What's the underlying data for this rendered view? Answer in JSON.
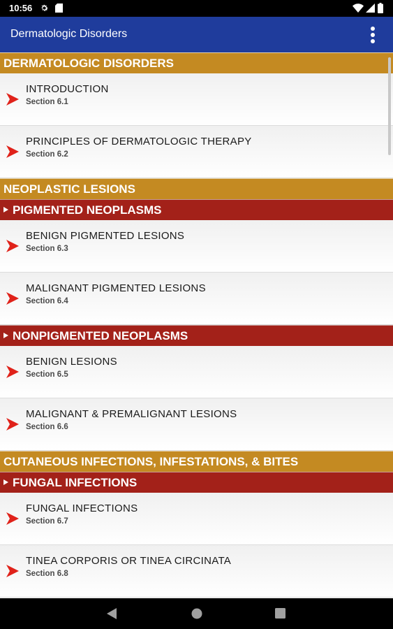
{
  "status_bar": {
    "time": "10:56",
    "icons": [
      "gear-icon",
      "sd-card-icon",
      "wifi-icon",
      "signal-icon",
      "battery-icon"
    ]
  },
  "app_bar": {
    "title": "Dermatologic Disorders",
    "menu_icon": "more-vert-icon"
  },
  "sections": {
    "dermatologic": "DERMATOLOGIC DISORDERS",
    "neoplastic": "NEOPLASTIC LESIONS",
    "cutaneous": "CUTANEOUS INFECTIONS, INFESTATIONS, & BITES"
  },
  "subsections": {
    "pigmented": "PIGMENTED NEOPLASMS",
    "nonpigmented": "NONPIGMENTED NEOPLASMS",
    "fungal": "FUNGAL INFECTIONS"
  },
  "items": [
    {
      "title": "INTRODUCTION",
      "section": "Section 6.1"
    },
    {
      "title": "PRINCIPLES OF DERMATOLOGIC THERAPY",
      "section": "Section 6.2"
    },
    {
      "title": "BENIGN PIGMENTED LESIONS",
      "section": "Section 6.3"
    },
    {
      "title": "MALIGNANT PIGMENTED LESIONS",
      "section": "Section 6.4"
    },
    {
      "title": "BENIGN LESIONS",
      "section": "Section 6.5"
    },
    {
      "title": "MALIGNANT & PREMALIGNANT LESIONS",
      "section": "Section 6.6"
    },
    {
      "title": "FUNGAL INFECTIONS",
      "section": "Section 6.7"
    },
    {
      "title": "TINEA CORPORIS OR TINEA CIRCINATA",
      "section": "Section 6.8"
    }
  ],
  "colors": {
    "app_bar": "#1f3c9c",
    "section_header": "#c48a22",
    "subsection_header": "#a32119",
    "chevron": "#e0221a"
  },
  "nav_bar": {
    "icons": [
      "back-icon",
      "home-icon",
      "recents-icon"
    ]
  }
}
